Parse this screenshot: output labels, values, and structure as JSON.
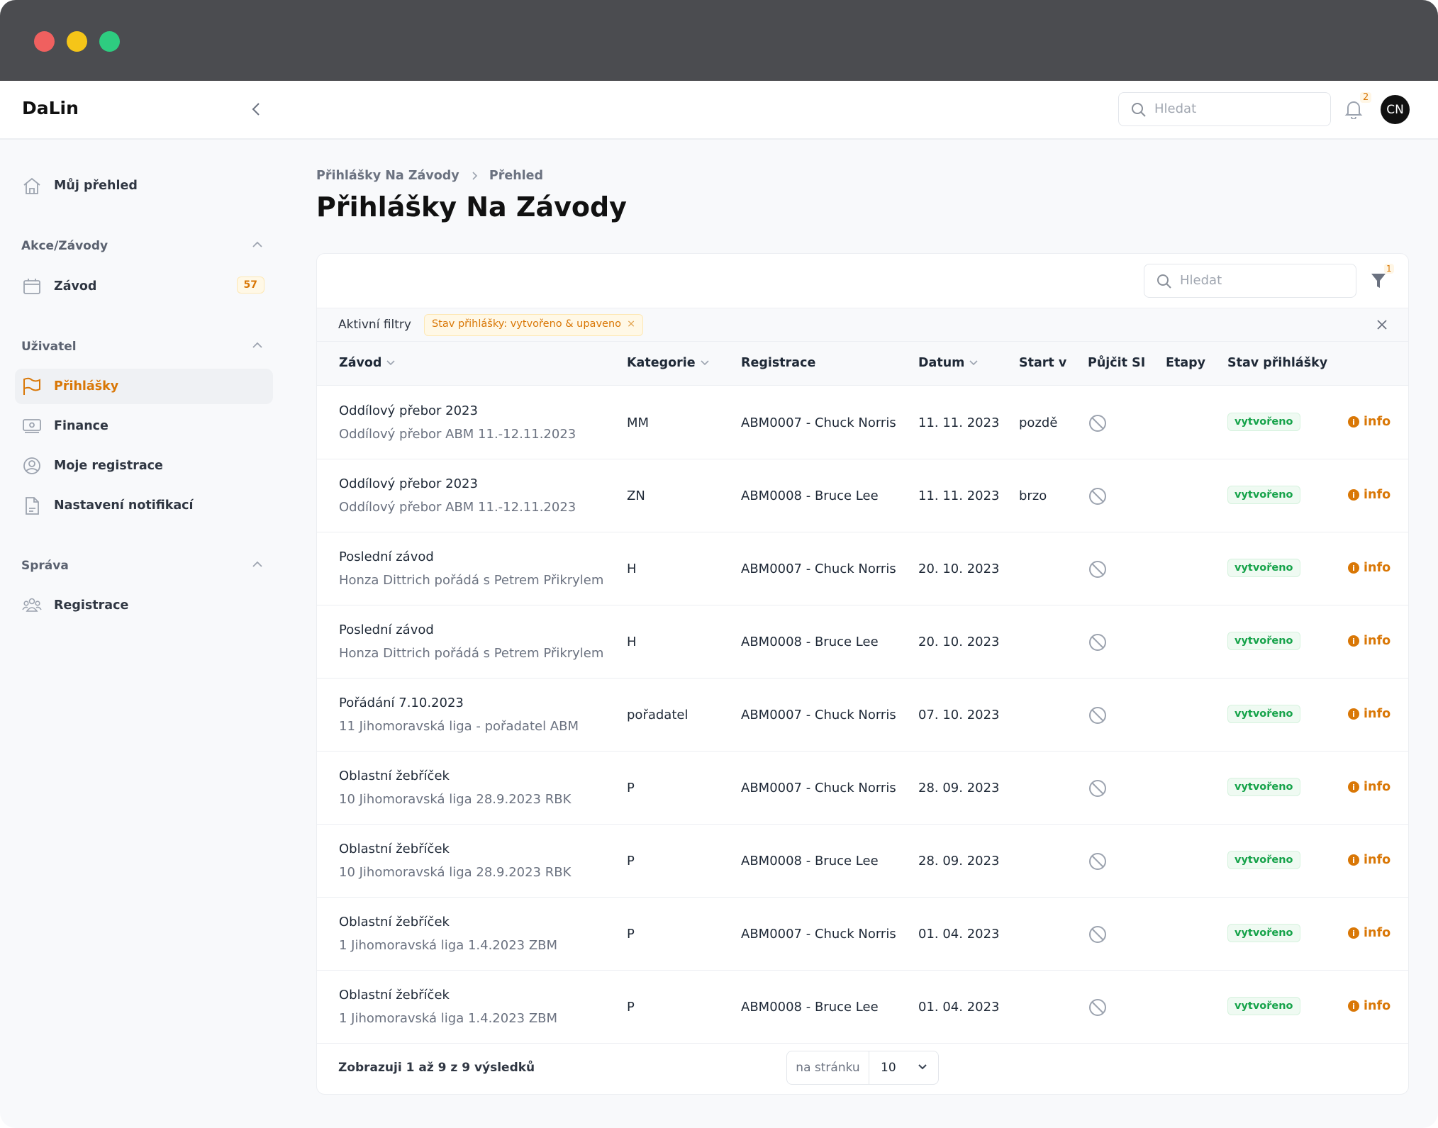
{
  "window": {
    "controls": [
      "close",
      "minimize",
      "maximize"
    ],
    "colors": {
      "close": "#f0605f",
      "minimize": "#f5c518",
      "maximize": "#2ecc80"
    }
  },
  "header": {
    "logo": "DaLin",
    "search_placeholder": "Hledat",
    "notification_count": "2",
    "avatar_initials": "CN"
  },
  "sidebar": {
    "home": {
      "label": "Můj přehled",
      "icon": "home-icon"
    },
    "sections": [
      {
        "title": "Akce/Závody",
        "items": [
          {
            "label": "Závod",
            "icon": "calendar-icon",
            "badge": "57"
          }
        ]
      },
      {
        "title": "Uživatel",
        "items": [
          {
            "label": "Přihlášky",
            "icon": "flag-icon",
            "active": true
          },
          {
            "label": "Finance",
            "icon": "banknote-icon"
          },
          {
            "label": "Moje registrace",
            "icon": "user-circle-icon"
          },
          {
            "label": "Nastavení notifikací",
            "icon": "document-icon"
          }
        ]
      },
      {
        "title": "Správa",
        "items": [
          {
            "label": "Registrace",
            "icon": "users-icon"
          }
        ]
      }
    ]
  },
  "breadcrumb": [
    "Přihlášky Na Závody",
    "Přehled"
  ],
  "page_title": "Přihlášky Na Závody",
  "table": {
    "search_placeholder": "Hledat",
    "filter_count": "1",
    "active_filters_label": "Aktivní filtry",
    "active_filter_chip": "Stav přihlášky: vytvořeno & upaveno",
    "columns": [
      "Závod",
      "Kategorie",
      "Registrace",
      "Datum",
      "Start v",
      "Půjčit SI",
      "Etapy",
      "Stav přihlášky"
    ],
    "info_label": "info",
    "rows": [
      {
        "race": "Oddílový přebor 2023",
        "race_sub": "Oddílový přebor ABM 11.-12.11.2023",
        "category": "MM",
        "registration": "ABM0007 - Chuck Norris",
        "date": "11. 11. 2023",
        "start": "pozdě",
        "status": "vytvořeno"
      },
      {
        "race": "Oddílový přebor 2023",
        "race_sub": "Oddílový přebor ABM 11.-12.11.2023",
        "category": "ZN",
        "registration": "ABM0008 - Bruce Lee",
        "date": "11. 11. 2023",
        "start": "brzo",
        "status": "vytvořeno"
      },
      {
        "race": "Poslední závod",
        "race_sub": "Honza Dittrich pořádá s Petrem Přikrylem",
        "category": "H",
        "registration": "ABM0007 - Chuck Norris",
        "date": "20. 10. 2023",
        "start": "",
        "status": "vytvořeno"
      },
      {
        "race": "Poslední závod",
        "race_sub": "Honza Dittrich pořádá s Petrem Přikrylem",
        "category": "H",
        "registration": "ABM0008 - Bruce Lee",
        "date": "20. 10. 2023",
        "start": "",
        "status": "vytvořeno"
      },
      {
        "race": "Pořádání 7.10.2023",
        "race_sub": "11 Jihomoravská liga - pořadatel ABM",
        "category": "pořadatel",
        "registration": "ABM0007 - Chuck Norris",
        "date": "07. 10. 2023",
        "start": "",
        "status": "vytvořeno"
      },
      {
        "race": "Oblastní žebříček",
        "race_sub": "10 Jihomoravská liga 28.9.2023 RBK",
        "category": "P",
        "registration": "ABM0007 - Chuck Norris",
        "date": "28. 09. 2023",
        "start": "",
        "status": "vytvořeno"
      },
      {
        "race": "Oblastní žebříček",
        "race_sub": "10 Jihomoravská liga 28.9.2023 RBK",
        "category": "P",
        "registration": "ABM0008 - Bruce Lee",
        "date": "28. 09. 2023",
        "start": "",
        "status": "vytvořeno"
      },
      {
        "race": "Oblastní žebříček",
        "race_sub": "1 Jihomoravská liga 1.4.2023 ZBM",
        "category": "P",
        "registration": "ABM0007 - Chuck Norris",
        "date": "01. 04. 2023",
        "start": "",
        "status": "vytvořeno"
      },
      {
        "race": "Oblastní žebříček",
        "race_sub": "1 Jihomoravská liga 1.4.2023 ZBM",
        "category": "P",
        "registration": "ABM0008 - Bruce Lee",
        "date": "01. 04. 2023",
        "start": "",
        "status": "vytvořeno"
      }
    ],
    "pagination": {
      "summary": "Zobrazuji 1 až 9 z 9 výsledků",
      "per_page_label": "na stránku",
      "per_page_value": "10"
    }
  },
  "colors": {
    "accent": "#d97706",
    "status_green": "#16a34a"
  }
}
